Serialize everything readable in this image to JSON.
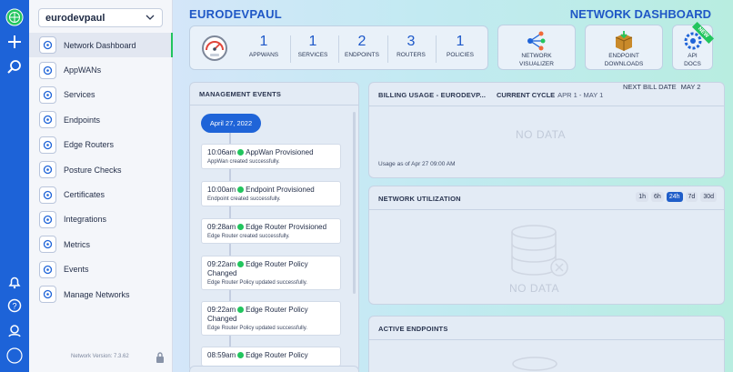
{
  "tenant": {
    "name": "eurodevpaul"
  },
  "nav": [
    {
      "label": "Network Dashboard",
      "icon": "dashboard-icon",
      "active": true
    },
    {
      "label": "AppWANs",
      "icon": "appwan-icon"
    },
    {
      "label": "Services",
      "icon": "services-icon"
    },
    {
      "label": "Endpoints",
      "icon": "endpoints-icon"
    },
    {
      "label": "Edge Routers",
      "icon": "edge-router-icon"
    },
    {
      "label": "Posture Checks",
      "icon": "posture-check-icon"
    },
    {
      "label": "Certificates",
      "icon": "certificate-icon"
    },
    {
      "label": "Integrations",
      "icon": "integrations-icon"
    },
    {
      "label": "Metrics",
      "icon": "metrics-icon"
    },
    {
      "label": "Events",
      "icon": "events-icon"
    },
    {
      "label": "Manage Networks",
      "icon": "globe-icon"
    }
  ],
  "version": "Network Version: 7.3.62",
  "header": {
    "org": "EURODEVPAUL",
    "title": "NETWORK DASHBOARD"
  },
  "stats": [
    {
      "value": "1",
      "label": "APPWANS"
    },
    {
      "value": "1",
      "label": "SERVICES"
    },
    {
      "value": "2",
      "label": "ENDPOINTS"
    },
    {
      "value": "3",
      "label": "ROUTERS"
    },
    {
      "value": "1",
      "label": "POLICIES"
    }
  ],
  "tiles": {
    "visualizer": [
      "NETWORK",
      "VISUALIZER"
    ],
    "downloads": [
      "ENDPOINT",
      "DOWNLOADS"
    ],
    "api": [
      "API",
      "DOCS"
    ],
    "new_badge": "NEW"
  },
  "events": {
    "title": "MANAGEMENT EVENTS",
    "date": "April 27, 2022",
    "items": [
      {
        "time": "10:06am",
        "title": "AppWan Provisioned",
        "desc": "AppWan created successfully."
      },
      {
        "time": "10:00am",
        "title": "Endpoint Provisioned",
        "desc": "Endpoint created successfully."
      },
      {
        "time": "09:28am",
        "title": "Edge Router Provisioned",
        "desc": "Edge Router created successfully."
      },
      {
        "time": "09:22am",
        "title": "Edge Router Policy Changed",
        "desc": "Edge Router Policy updated successfully."
      },
      {
        "time": "09:22am",
        "title": "Edge Router Policy Changed",
        "desc": "Edge Router Policy updated successfully."
      },
      {
        "time": "08:59am",
        "title": "Edge Router Policy",
        "desc": ""
      }
    ]
  },
  "billing": {
    "title": "BILLING USAGE - EURODEVP...",
    "cycle_label": "CURRENT CYCLE",
    "cycle_value": "APR 1 - MAY 1",
    "next_label": "NEXT BILL DATE",
    "next_value": "MAY 2",
    "no_data": "NO DATA",
    "usage_note": "Usage as of Apr 27 09:00 AM"
  },
  "utilization": {
    "title": "NETWORK UTILIZATION",
    "ranges": [
      "1h",
      "6h",
      "24h",
      "7d",
      "30d"
    ],
    "selected": "24h",
    "no_data": "NO DATA"
  },
  "endpoints": {
    "title": "ACTIVE ENDPOINTS"
  },
  "colors": {
    "accent": "#1f5ec9",
    "rail": "#1d63d8",
    "success": "#22c55e"
  }
}
